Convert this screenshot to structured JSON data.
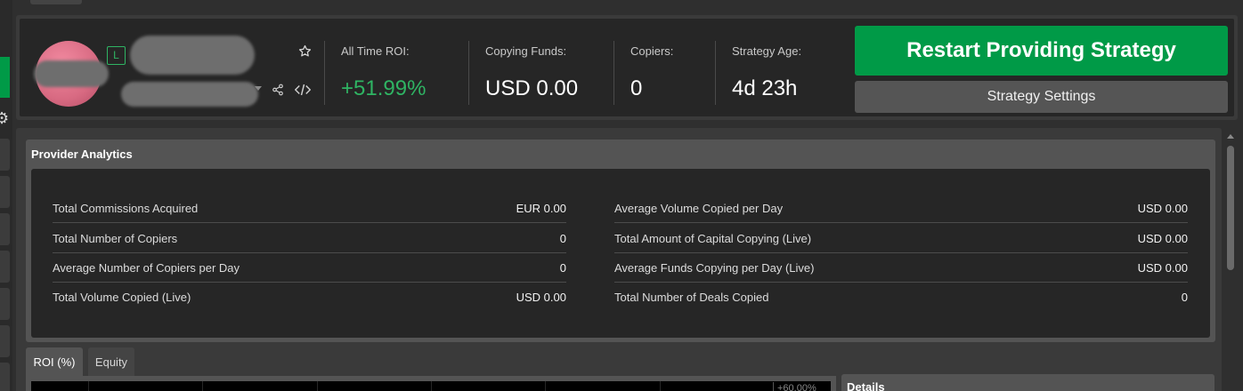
{
  "header": {
    "level_badge": "L",
    "stats": [
      {
        "label": "All Time ROI:",
        "value": "+51.99%"
      },
      {
        "label": "Copying Funds:",
        "value": "USD 0.00"
      },
      {
        "label": "Copiers:",
        "value": "0"
      },
      {
        "label": "Strategy Age:",
        "value": "4d 23h"
      }
    ],
    "primary_button": "Restart Providing Strategy",
    "secondary_button": "Strategy Settings"
  },
  "analytics": {
    "title": "Provider Analytics",
    "left_rows": [
      {
        "label": "Total Commissions Acquired",
        "value": "EUR 0.00"
      },
      {
        "label": "Total Number of Copiers",
        "value": "0"
      },
      {
        "label": "Average Number of Copiers per Day",
        "value": "0"
      },
      {
        "label": "Total Volume Copied (Live)",
        "value": "USD 0.00"
      }
    ],
    "right_rows": [
      {
        "label": "Average Volume Copied per Day",
        "value": "USD 0.00"
      },
      {
        "label": "Total Amount of Capital Copying (Live)",
        "value": "USD 0.00"
      },
      {
        "label": "Average Funds Copying per Day (Live)",
        "value": "USD 0.00"
      },
      {
        "label": "Total Number of Deals Copied",
        "value": "0"
      }
    ]
  },
  "chart_tabs": [
    {
      "label": "ROI (%)",
      "active": true
    },
    {
      "label": "Equity",
      "active": false
    }
  ],
  "chart": {
    "axis_label_partial": "+60.00%"
  },
  "details": {
    "title": "Details"
  },
  "icons": {
    "favorite": "star-outline-icon",
    "share": "share-icon",
    "embed": "code-icon",
    "settings": "gear-icon"
  },
  "colors": {
    "accent": "#009a47",
    "positive": "#2fb463",
    "panel": "#545454",
    "background": "#2f2f2f"
  }
}
